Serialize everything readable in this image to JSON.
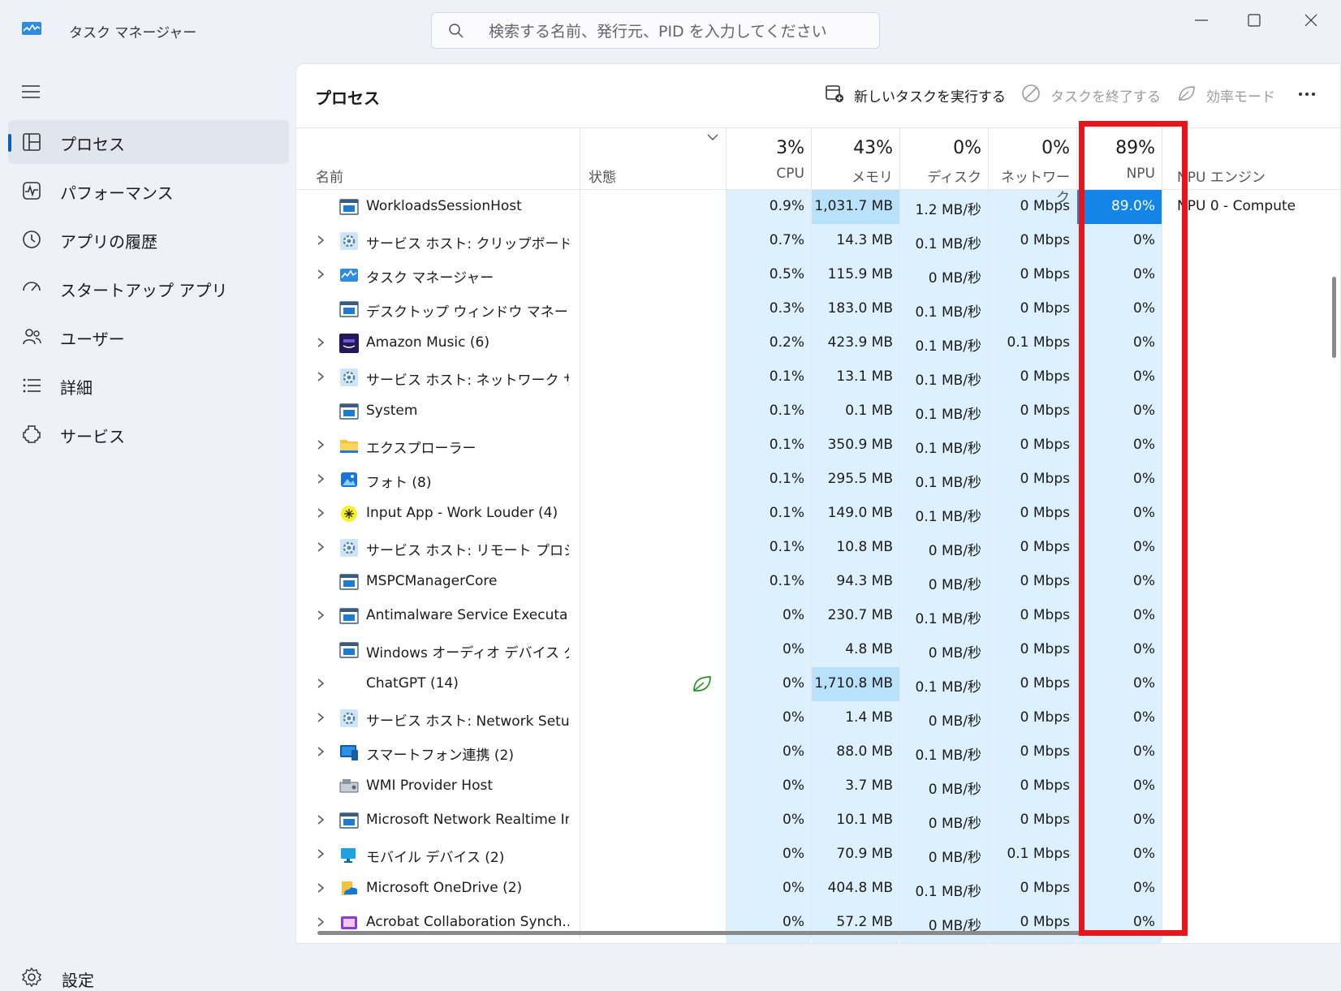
{
  "window": {
    "title": "タスク マネージャー"
  },
  "search": {
    "placeholder": "検索する名前、発行元、PID を入力してください"
  },
  "sidebar": {
    "items": [
      {
        "label": "プロセス",
        "icon": "processes-icon",
        "active": true
      },
      {
        "label": "パフォーマンス",
        "icon": "performance-icon"
      },
      {
        "label": "アプリの履歴",
        "icon": "history-icon"
      },
      {
        "label": "スタートアップ アプリ",
        "icon": "startup-icon"
      },
      {
        "label": "ユーザー",
        "icon": "users-icon"
      },
      {
        "label": "詳細",
        "icon": "details-icon"
      },
      {
        "label": "サービス",
        "icon": "services-icon"
      }
    ],
    "settings_label": "設定"
  },
  "main": {
    "title": "プロセス",
    "run_new_task": "新しいタスクを実行する",
    "end_task": "タスクを終了する",
    "efficiency_mode": "効率モード"
  },
  "columns": {
    "name": "名前",
    "status": "状態",
    "cpu": {
      "pct": "3%",
      "label": "CPU"
    },
    "memory": {
      "pct": "43%",
      "label": "メモリ"
    },
    "disk": {
      "pct": "0%",
      "label": "ディスク"
    },
    "network": {
      "pct": "0%",
      "label": "ネットワーク"
    },
    "npu": {
      "pct": "89%",
      "label": "NPU"
    },
    "npu_engine": "NPU エンジン"
  },
  "colors": {
    "usage_light": "#dcf1fd",
    "usage_medium": "#b9e1f9",
    "usage_high": "#1485e8",
    "highlight_box": "#e8141b",
    "accent": "#0a5fb8"
  },
  "processes": [
    {
      "name": "WorkloadsSessionHost",
      "icon": "window-icon",
      "expandable": false,
      "cpu": "0.9%",
      "memory": "1,031.7 MB",
      "disk": "1.2 MB/秒",
      "network": "0 Mbps",
      "npu": "89.0%",
      "npu_engine": "NPU 0 - Compute",
      "mem_high": true,
      "npu_high": true
    },
    {
      "name": "サービス ホスト: クリップボード ユー...",
      "icon": "gear-icon",
      "expandable": true,
      "cpu": "0.7%",
      "memory": "14.3 MB",
      "disk": "0.1 MB/秒",
      "network": "0 Mbps",
      "npu": "0%"
    },
    {
      "name": "タスク マネージャー",
      "icon": "taskmgr-icon",
      "expandable": true,
      "cpu": "0.5%",
      "memory": "115.9 MB",
      "disk": "0 MB/秒",
      "network": "0 Mbps",
      "npu": "0%"
    },
    {
      "name": "デスクトップ ウィンドウ マネージャー",
      "icon": "window-icon",
      "expandable": false,
      "cpu": "0.3%",
      "memory": "183.0 MB",
      "disk": "0.1 MB/秒",
      "network": "0 Mbps",
      "npu": "0%"
    },
    {
      "name": "Amazon Music (6)",
      "icon": "amazon-music-icon",
      "expandable": true,
      "cpu": "0.2%",
      "memory": "423.9 MB",
      "disk": "0.1 MB/秒",
      "network": "0.1 Mbps",
      "npu": "0%"
    },
    {
      "name": "サービス ホスト: ネットワーク サービス",
      "icon": "gear-icon",
      "expandable": true,
      "cpu": "0.1%",
      "memory": "13.1 MB",
      "disk": "0.1 MB/秒",
      "network": "0 Mbps",
      "npu": "0%"
    },
    {
      "name": "System",
      "icon": "window-icon",
      "expandable": false,
      "cpu": "0.1%",
      "memory": "0.1 MB",
      "disk": "0.1 MB/秒",
      "network": "0 Mbps",
      "npu": "0%"
    },
    {
      "name": "エクスプローラー",
      "icon": "folder-icon",
      "expandable": true,
      "cpu": "0.1%",
      "memory": "350.9 MB",
      "disk": "0.1 MB/秒",
      "network": "0 Mbps",
      "npu": "0%"
    },
    {
      "name": "フォト (8)",
      "icon": "photos-icon",
      "expandable": true,
      "cpu": "0.1%",
      "memory": "295.5 MB",
      "disk": "0.1 MB/秒",
      "network": "0 Mbps",
      "npu": "0%"
    },
    {
      "name": "Input App - Work Louder (4)",
      "icon": "input-app-icon",
      "expandable": true,
      "cpu": "0.1%",
      "memory": "149.0 MB",
      "disk": "0.1 MB/秒",
      "network": "0 Mbps",
      "npu": "0%"
    },
    {
      "name": "サービス ホスト: リモート プロシージ...",
      "icon": "gear-icon",
      "expandable": true,
      "cpu": "0.1%",
      "memory": "10.8 MB",
      "disk": "0 MB/秒",
      "network": "0 Mbps",
      "npu": "0%"
    },
    {
      "name": "MSPCManagerCore",
      "icon": "window-icon",
      "expandable": false,
      "cpu": "0.1%",
      "memory": "94.3 MB",
      "disk": "0 MB/秒",
      "network": "0 Mbps",
      "npu": "0%"
    },
    {
      "name": "Antimalware Service Executable",
      "icon": "window-icon",
      "expandable": true,
      "cpu": "0%",
      "memory": "230.7 MB",
      "disk": "0.1 MB/秒",
      "network": "0 Mbps",
      "npu": "0%"
    },
    {
      "name": "Windows オーディオ デバイス グラ...",
      "icon": "window-icon",
      "expandable": false,
      "cpu": "0%",
      "memory": "4.8 MB",
      "disk": "0 MB/秒",
      "network": "0 Mbps",
      "npu": "0%"
    },
    {
      "name": "ChatGPT (14)",
      "icon": "blank-icon",
      "expandable": true,
      "cpu": "0%",
      "memory": "1,710.8 MB",
      "disk": "0.1 MB/秒",
      "network": "0 Mbps",
      "npu": "0%",
      "mem_high": true,
      "eco": true
    },
    {
      "name": "サービス ホスト: Network Setup ...",
      "icon": "gear-icon",
      "expandable": true,
      "cpu": "0%",
      "memory": "1.4 MB",
      "disk": "0 MB/秒",
      "network": "0 Mbps",
      "npu": "0%"
    },
    {
      "name": "スマートフォン連携 (2)",
      "icon": "phone-link-icon",
      "expandable": true,
      "cpu": "0%",
      "memory": "88.0 MB",
      "disk": "0.1 MB/秒",
      "network": "0 Mbps",
      "npu": "0%"
    },
    {
      "name": "WMI Provider Host",
      "icon": "wmi-icon",
      "expandable": false,
      "cpu": "0%",
      "memory": "3.7 MB",
      "disk": "0 MB/秒",
      "network": "0 Mbps",
      "npu": "0%"
    },
    {
      "name": "Microsoft Network Realtime In...",
      "icon": "window-icon",
      "expandable": true,
      "cpu": "0%",
      "memory": "10.1 MB",
      "disk": "0 MB/秒",
      "network": "0 Mbps",
      "npu": "0%"
    },
    {
      "name": "モバイル デバイス (2)",
      "icon": "mobile-device-icon",
      "expandable": true,
      "cpu": "0%",
      "memory": "70.9 MB",
      "disk": "0 MB/秒",
      "network": "0.1 Mbps",
      "npu": "0%"
    },
    {
      "name": "Microsoft OneDrive (2)",
      "icon": "onedrive-icon",
      "expandable": true,
      "cpu": "0%",
      "memory": "404.8 MB",
      "disk": "0.1 MB/秒",
      "network": "0 Mbps",
      "npu": "0%"
    },
    {
      "name": "Acrobat Collaboration Synch...",
      "icon": "acrobat-icon",
      "expandable": true,
      "cpu": "0%",
      "memory": "57.2 MB",
      "disk": "0 MB/秒",
      "network": "0 Mbps",
      "npu": "0%"
    }
  ]
}
